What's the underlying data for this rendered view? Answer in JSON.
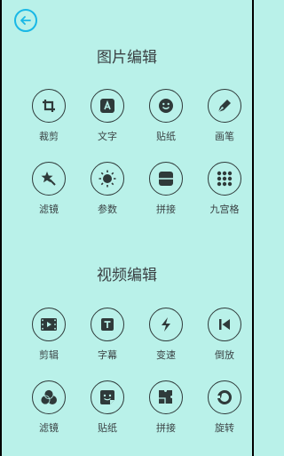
{
  "header": {
    "back_icon": "arrow-left-icon",
    "accent": "#19b8e6"
  },
  "image_section": {
    "title": "图片编辑",
    "rows": [
      [
        {
          "label": "裁剪",
          "icon": "crop-icon"
        },
        {
          "label": "文字",
          "icon": "text-icon"
        },
        {
          "label": "贴纸",
          "icon": "smiley-icon"
        },
        {
          "label": "画笔",
          "icon": "pen-icon"
        }
      ],
      [
        {
          "label": "滤镜",
          "icon": "star-wand-icon"
        },
        {
          "label": "参数",
          "icon": "brightness-icon"
        },
        {
          "label": "拼接",
          "icon": "split-icon"
        },
        {
          "label": "九宫格",
          "icon": "nine-grid-icon"
        }
      ]
    ]
  },
  "video_section": {
    "title": "视频编辑",
    "rows": [
      [
        {
          "label": "剪辑",
          "icon": "film-icon"
        },
        {
          "label": "字幕",
          "icon": "subtitle-icon"
        },
        {
          "label": "变速",
          "icon": "lightning-icon"
        },
        {
          "label": "倒放",
          "icon": "reverse-icon"
        }
      ],
      [
        {
          "label": "滤镜",
          "icon": "filter-circles-icon"
        },
        {
          "label": "贴纸",
          "icon": "sticker-icon"
        },
        {
          "label": "拼接",
          "icon": "puzzle-icon"
        },
        {
          "label": "旋转",
          "icon": "rotate-icon"
        }
      ]
    ]
  }
}
